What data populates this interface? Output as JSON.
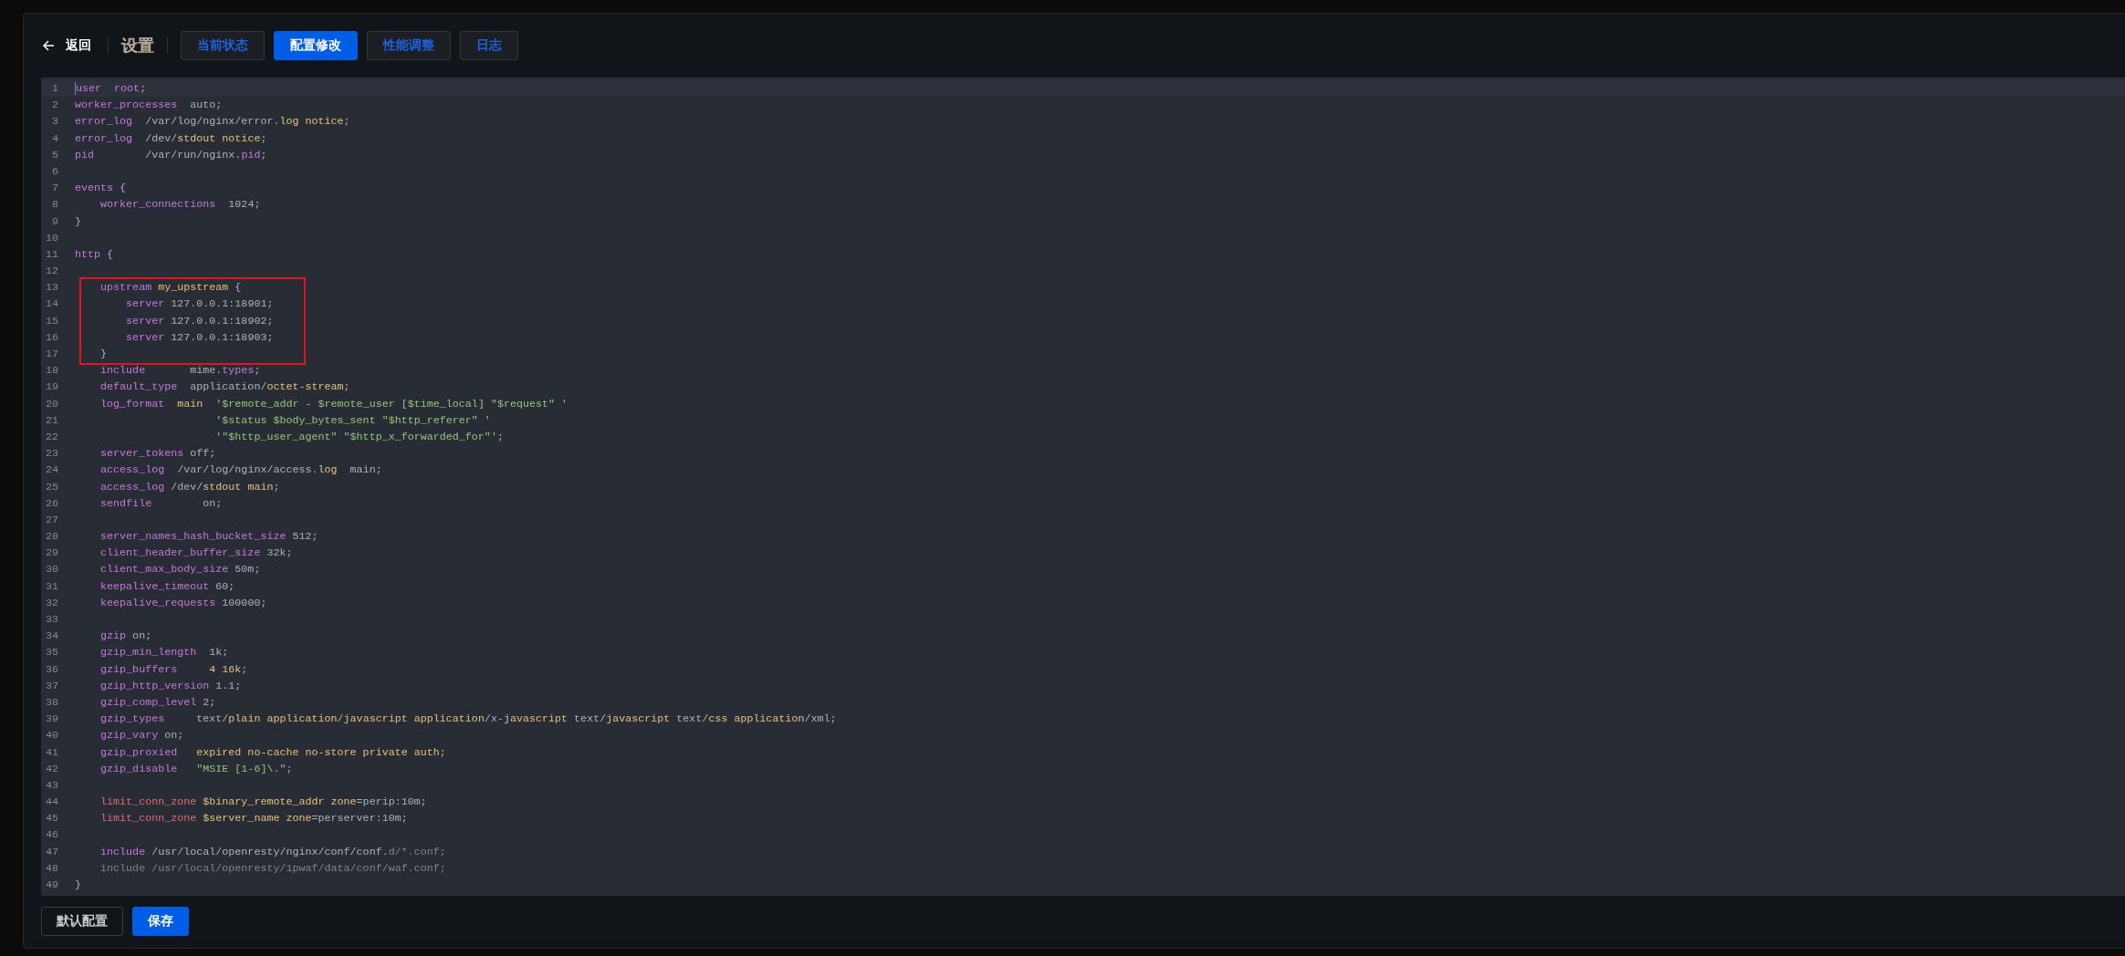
{
  "header": {
    "back": "返回",
    "title": "设置"
  },
  "tabs": [
    {
      "label": "当前状态",
      "selected": false
    },
    {
      "label": "配置修改",
      "selected": true
    },
    {
      "label": "性能调整",
      "selected": false
    },
    {
      "label": "日志",
      "selected": false
    }
  ],
  "editor": {
    "lines": [
      {
        "number": "1",
        "active": true,
        "highlighted": false,
        "tokens": [
          {
            "text": "user  root",
            "kind": "directive"
          },
          {
            "text": ";",
            "kind": "plain"
          }
        ]
      },
      {
        "number": "2",
        "active": false,
        "highlighted": false,
        "tokens": [
          {
            "text": "worker_processes",
            "kind": "directive"
          },
          {
            "text": "  auto;",
            "kind": "plain"
          }
        ]
      },
      {
        "number": "3",
        "active": false,
        "highlighted": false,
        "tokens": [
          {
            "text": "error_log",
            "kind": "directive"
          },
          {
            "text": "  /var/log/nginx/error.",
            "kind": "plain"
          },
          {
            "text": "log notice",
            "kind": "value"
          },
          {
            "text": ";",
            "kind": "plain"
          }
        ]
      },
      {
        "number": "4",
        "active": false,
        "highlighted": false,
        "tokens": [
          {
            "text": "error_log",
            "kind": "directive"
          },
          {
            "text": "  /dev/",
            "kind": "plain"
          },
          {
            "text": "stdout notice",
            "kind": "value"
          },
          {
            "text": ";",
            "kind": "plain"
          }
        ]
      },
      {
        "number": "5",
        "active": false,
        "highlighted": false,
        "tokens": [
          {
            "text": "pid",
            "kind": "directive"
          },
          {
            "text": "        /var/run/nginx.",
            "kind": "plain"
          },
          {
            "text": "pid",
            "kind": "directive"
          },
          {
            "text": ";",
            "kind": "plain"
          }
        ]
      },
      {
        "number": "6",
        "active": false,
        "highlighted": false
      },
      {
        "number": "7",
        "active": false,
        "highlighted": false,
        "tokens": [
          {
            "text": "events",
            "kind": "directive"
          },
          {
            "text": " {",
            "kind": "plain"
          }
        ]
      },
      {
        "number": "8",
        "active": false,
        "highlighted": false,
        "tokens": [
          {
            "text": "    worker_connections",
            "kind": "directive"
          },
          {
            "text": "  1024;",
            "kind": "plain"
          }
        ]
      },
      {
        "number": "9",
        "active": false,
        "highlighted": false,
        "tokens": [
          {
            "text": "}",
            "kind": "plain"
          }
        ]
      },
      {
        "number": "10",
        "active": false,
        "highlighted": false
      },
      {
        "number": "11",
        "active": false,
        "highlighted": false,
        "tokens": [
          {
            "text": "http",
            "kind": "directive"
          },
          {
            "text": " {",
            "kind": "plain"
          }
        ]
      },
      {
        "number": "12",
        "active": false,
        "highlighted": false
      },
      {
        "number": "13",
        "active": false,
        "highlighted": true,
        "tokens": [
          {
            "text": "    upstream",
            "kind": "directive"
          },
          {
            "text": " my_upstream",
            "kind": "value"
          },
          {
            "text": " {",
            "kind": "plain"
          }
        ]
      },
      {
        "number": "14",
        "active": false,
        "highlighted": true,
        "tokens": [
          {
            "text": "        server",
            "kind": "directive"
          },
          {
            "text": " 127.0.0.1:18901;",
            "kind": "plain"
          }
        ]
      },
      {
        "number": "15",
        "active": false,
        "highlighted": true,
        "tokens": [
          {
            "text": "        server",
            "kind": "directive"
          },
          {
            "text": " 127.0.0.1:18902;",
            "kind": "plain"
          }
        ]
      },
      {
        "number": "16",
        "active": false,
        "highlighted": true,
        "tokens": [
          {
            "text": "        server",
            "kind": "directive"
          },
          {
            "text": " 127.0.0.1:18903;",
            "kind": "plain"
          }
        ]
      },
      {
        "number": "17",
        "active": false,
        "highlighted": true,
        "tokens": [
          {
            "text": "    }",
            "kind": "plain"
          }
        ]
      },
      {
        "number": "18",
        "active": false,
        "highlighted": false,
        "tokens": [
          {
            "text": "    include",
            "kind": "directive"
          },
          {
            "text": "       mime.",
            "kind": "plain"
          },
          {
            "text": "types",
            "kind": "directive"
          },
          {
            "text": ";",
            "kind": "plain"
          }
        ]
      },
      {
        "number": "19",
        "active": false,
        "highlighted": false,
        "tokens": [
          {
            "text": "    default_type",
            "kind": "directive"
          },
          {
            "text": "  application/",
            "kind": "plain"
          },
          {
            "text": "octet-stream",
            "kind": "value"
          },
          {
            "text": ";",
            "kind": "plain"
          }
        ]
      },
      {
        "number": "20",
        "active": false,
        "highlighted": false,
        "tokens": [
          {
            "text": "    log_format",
            "kind": "directive"
          },
          {
            "text": "  main",
            "kind": "value"
          },
          {
            "text": "  '$remote_addr - $remote_user [$time_local] \"$request\" '",
            "kind": "string"
          }
        ]
      },
      {
        "number": "21",
        "active": false,
        "highlighted": false,
        "tokens": [
          {
            "text": "                      '$status $body_bytes_sent \"$http_referer\" '",
            "kind": "string"
          }
        ]
      },
      {
        "number": "22",
        "active": false,
        "highlighted": false,
        "tokens": [
          {
            "text": "                      '\"$http_user_agent\" \"$http_x_forwarded_for\"'",
            "kind": "string"
          },
          {
            "text": ";",
            "kind": "plain"
          }
        ]
      },
      {
        "number": "23",
        "active": false,
        "highlighted": false,
        "tokens": [
          {
            "text": "    server_tokens",
            "kind": "directive"
          },
          {
            "text": " off;",
            "kind": "plain"
          }
        ]
      },
      {
        "number": "24",
        "active": false,
        "highlighted": false,
        "tokens": [
          {
            "text": "    access_log",
            "kind": "directive"
          },
          {
            "text": "  /var/log/nginx/access.",
            "kind": "plain"
          },
          {
            "text": "log",
            "kind": "value"
          },
          {
            "text": "  main;",
            "kind": "plain"
          }
        ]
      },
      {
        "number": "25",
        "active": false,
        "highlighted": false,
        "tokens": [
          {
            "text": "    access_log",
            "kind": "directive"
          },
          {
            "text": " /dev/",
            "kind": "plain"
          },
          {
            "text": "stdout main",
            "kind": "value"
          },
          {
            "text": ";",
            "kind": "plain"
          }
        ]
      },
      {
        "number": "26",
        "active": false,
        "highlighted": false,
        "tokens": [
          {
            "text": "    sendfile",
            "kind": "directive"
          },
          {
            "text": "        on;",
            "kind": "plain"
          }
        ]
      },
      {
        "number": "27",
        "active": false,
        "highlighted": false
      },
      {
        "number": "28",
        "active": false,
        "highlighted": false,
        "tokens": [
          {
            "text": "    server_names_hash_bucket_size",
            "kind": "directive"
          },
          {
            "text": " 512;",
            "kind": "plain"
          }
        ]
      },
      {
        "number": "29",
        "active": false,
        "highlighted": false,
        "tokens": [
          {
            "text": "    client_header_buffer_size",
            "kind": "directive"
          },
          {
            "text": " 32k;",
            "kind": "plain"
          }
        ]
      },
      {
        "number": "30",
        "active": false,
        "highlighted": false,
        "tokens": [
          {
            "text": "    client_max_body_size",
            "kind": "directive"
          },
          {
            "text": " 50m;",
            "kind": "plain"
          }
        ]
      },
      {
        "number": "31",
        "active": false,
        "highlighted": false,
        "tokens": [
          {
            "text": "    keepalive_timeout",
            "kind": "directive"
          },
          {
            "text": " 60;",
            "kind": "plain"
          }
        ]
      },
      {
        "number": "32",
        "active": false,
        "highlighted": false,
        "tokens": [
          {
            "text": "    keepalive_requests",
            "kind": "directive"
          },
          {
            "text": " 100000;",
            "kind": "plain"
          }
        ]
      },
      {
        "number": "33",
        "active": false,
        "highlighted": false
      },
      {
        "number": "34",
        "active": false,
        "highlighted": false,
        "tokens": [
          {
            "text": "    gzip",
            "kind": "directive"
          },
          {
            "text": " on;",
            "kind": "plain"
          }
        ]
      },
      {
        "number": "35",
        "active": false,
        "highlighted": false,
        "tokens": [
          {
            "text": "    gzip_min_length",
            "kind": "directive"
          },
          {
            "text": "  1k;",
            "kind": "plain"
          }
        ]
      },
      {
        "number": "36",
        "active": false,
        "highlighted": false,
        "tokens": [
          {
            "text": "    gzip_buffers",
            "kind": "directive"
          },
          {
            "text": "     4 16k",
            "kind": "value"
          },
          {
            "text": ";",
            "kind": "plain"
          }
        ]
      },
      {
        "number": "37",
        "active": false,
        "highlighted": false,
        "tokens": [
          {
            "text": "    gzip_http_version",
            "kind": "directive"
          },
          {
            "text": " 1.1;",
            "kind": "plain"
          }
        ]
      },
      {
        "number": "38",
        "active": false,
        "highlighted": false,
        "tokens": [
          {
            "text": "    gzip_comp_level",
            "kind": "directive"
          },
          {
            "text": " 2;",
            "kind": "plain"
          }
        ]
      },
      {
        "number": "39",
        "active": false,
        "highlighted": false,
        "tokens": [
          {
            "text": "    gzip_types",
            "kind": "directive"
          },
          {
            "text": "     text/",
            "kind": "plain"
          },
          {
            "text": "plain application",
            "kind": "value"
          },
          {
            "text": "/",
            "kind": "plain"
          },
          {
            "text": "javascript application",
            "kind": "value"
          },
          {
            "text": "/x-",
            "kind": "plain"
          },
          {
            "text": "javascript",
            "kind": "value"
          },
          {
            "text": " text/",
            "kind": "plain"
          },
          {
            "text": "javascript",
            "kind": "value"
          },
          {
            "text": " text/",
            "kind": "plain"
          },
          {
            "text": "css application",
            "kind": "value"
          },
          {
            "text": "/xml;",
            "kind": "plain"
          }
        ]
      },
      {
        "number": "40",
        "active": false,
        "highlighted": false,
        "tokens": [
          {
            "text": "    gzip_vary",
            "kind": "directive"
          },
          {
            "text": " on;",
            "kind": "plain"
          }
        ]
      },
      {
        "number": "41",
        "active": false,
        "highlighted": false,
        "tokens": [
          {
            "text": "    gzip_proxied",
            "kind": "directive"
          },
          {
            "text": "   expired no-cache no-store private auth",
            "kind": "value"
          },
          {
            "text": ";",
            "kind": "plain"
          }
        ]
      },
      {
        "number": "42",
        "active": false,
        "highlighted": false,
        "tokens": [
          {
            "text": "    gzip_disable",
            "kind": "directive"
          },
          {
            "text": "   \"MSIE [1-6]\\.\"",
            "kind": "string"
          },
          {
            "text": ";",
            "kind": "plain"
          }
        ]
      },
      {
        "number": "43",
        "active": false,
        "highlighted": false
      },
      {
        "number": "44",
        "active": false,
        "highlighted": false,
        "tokens": [
          {
            "text": "    limit_conn_zone",
            "kind": "error"
          },
          {
            "text": " $binary_remote_addr zone",
            "kind": "value"
          },
          {
            "text": "=perip:10m;",
            "kind": "plain"
          }
        ]
      },
      {
        "number": "45",
        "active": false,
        "highlighted": false,
        "tokens": [
          {
            "text": "    limit_conn_zone",
            "kind": "error"
          },
          {
            "text": " $server_name zone",
            "kind": "value"
          },
          {
            "text": "=perserver:10m;",
            "kind": "plain"
          }
        ]
      },
      {
        "number": "46",
        "active": false,
        "highlighted": false
      },
      {
        "number": "47",
        "active": false,
        "highlighted": false,
        "tokens": [
          {
            "text": "    include",
            "kind": "directive"
          },
          {
            "text": " /usr/local/openresty/nginx/conf/conf.",
            "kind": "plain"
          },
          {
            "text": "d/*.conf;",
            "kind": "muted"
          }
        ]
      },
      {
        "number": "48",
        "active": false,
        "highlighted": false,
        "tokens": [
          {
            "text": "    include /usr/local/openresty/1pwaf/data/conf/waf.conf;",
            "kind": "muted"
          }
        ]
      },
      {
        "number": "49",
        "active": false,
        "highlighted": false,
        "tokens": [
          {
            "text": "}",
            "kind": "plain"
          }
        ]
      }
    ]
  },
  "buttons": [
    {
      "label": "默认配置",
      "kind": "secondary"
    },
    {
      "label": "保存",
      "kind": "primary"
    }
  ]
}
